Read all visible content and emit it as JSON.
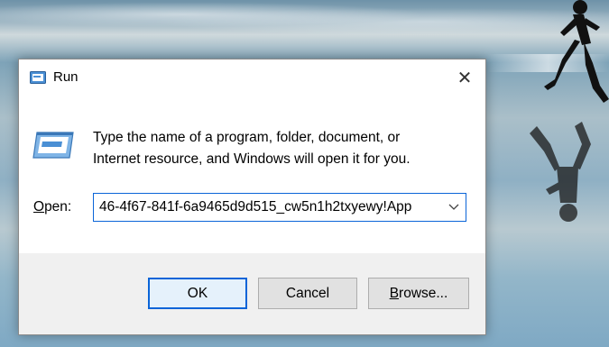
{
  "window": {
    "title": "Run",
    "close_glyph": "✕"
  },
  "prompt": {
    "line1": "Type the name of a program, folder, document, or",
    "line2": "Internet resource, and Windows will open it for you."
  },
  "open_field": {
    "label_mnemonic": "O",
    "label_rest": "pen:",
    "value": "46-4f67-841f-6a9465d9d515_cw5n1h2txyewy!App"
  },
  "buttons": {
    "ok": "OK",
    "cancel": "Cancel",
    "browse_mnemonic": "B",
    "browse_rest": "rowse..."
  },
  "colors": {
    "accent": "#0a64d8",
    "footer": "#f0f0f0"
  },
  "icons": {
    "app": "run-icon",
    "close": "close-icon",
    "dropdown": "chevron-down-icon"
  }
}
